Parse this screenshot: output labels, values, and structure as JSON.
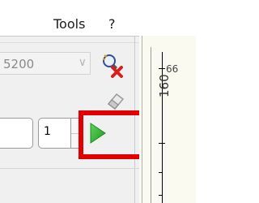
{
  "menubar": {
    "tools_label": "Tools",
    "help_label": "?"
  },
  "toolbar": {
    "combo_value": "5200",
    "combo_arrow_icon": "chevron-down-icon",
    "cancel_icon": "magnifier-cancel-icon",
    "eraser_icon": "eraser-icon",
    "number_value": "1",
    "play_icon": "play-icon",
    "play_color": "#2fb52f",
    "highlight_color": "#e00000"
  },
  "ruler": {
    "top_label": "66",
    "side_label": "160"
  }
}
